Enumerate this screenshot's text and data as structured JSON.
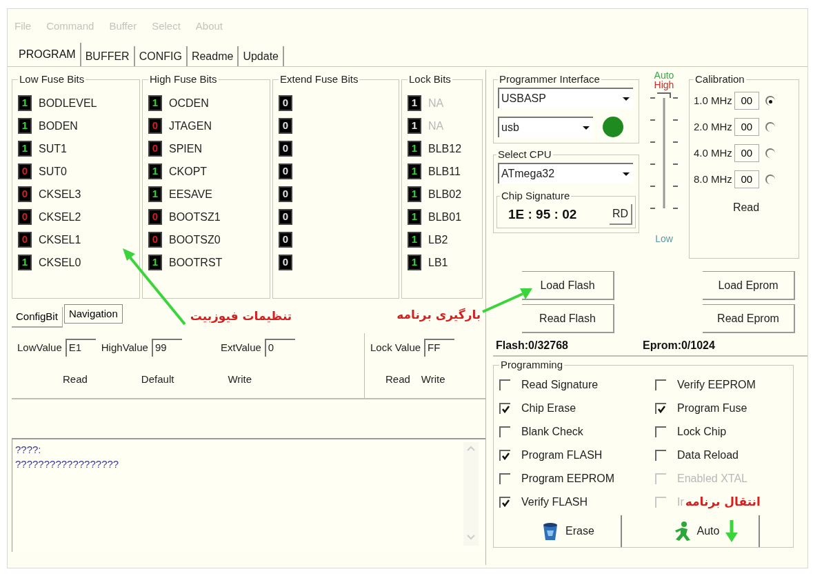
{
  "menu": [
    "File",
    "Command",
    "Buffer",
    "Select",
    "About"
  ],
  "tabs": [
    {
      "label": "PROGRAM",
      "selected": true
    },
    {
      "label": "BUFFER",
      "selected": false
    },
    {
      "label": "CONFIG",
      "selected": false
    },
    {
      "label": "Readme",
      "selected": false
    },
    {
      "label": "Update",
      "selected": false
    }
  ],
  "fuse_groups": [
    {
      "title": "Low Fuse Bits",
      "bits": [
        {
          "value": "1",
          "name": "BODLEVEL",
          "set": true,
          "active": true
        },
        {
          "value": "1",
          "name": "BODEN",
          "set": true,
          "active": true
        },
        {
          "value": "1",
          "name": "SUT1",
          "set": true,
          "active": true
        },
        {
          "value": "0",
          "name": "SUT0",
          "set": false,
          "active": true
        },
        {
          "value": "0",
          "name": "CKSEL3",
          "set": false,
          "active": true
        },
        {
          "value": "0",
          "name": "CKSEL2",
          "set": false,
          "active": true
        },
        {
          "value": "0",
          "name": "CKSEL1",
          "set": false,
          "active": true
        },
        {
          "value": "1",
          "name": "CKSEL0",
          "set": true,
          "active": true
        }
      ]
    },
    {
      "title": "High Fuse Bits",
      "bits": [
        {
          "value": "1",
          "name": "OCDEN",
          "set": true,
          "active": true
        },
        {
          "value": "0",
          "name": "JTAGEN",
          "set": false,
          "active": true
        },
        {
          "value": "0",
          "name": "SPIEN",
          "set": false,
          "active": true
        },
        {
          "value": "1",
          "name": "CKOPT",
          "set": true,
          "active": true
        },
        {
          "value": "1",
          "name": "EESAVE",
          "set": true,
          "active": true
        },
        {
          "value": "0",
          "name": "BOOTSZ1",
          "set": false,
          "active": true
        },
        {
          "value": "0",
          "name": "BOOTSZ0",
          "set": false,
          "active": true
        },
        {
          "value": "1",
          "name": "BOOTRST",
          "set": true,
          "active": true
        }
      ]
    },
    {
      "title": "Extend Fuse Bits",
      "bits": [
        {
          "value": "0",
          "active": false
        },
        {
          "value": "0",
          "active": false
        },
        {
          "value": "0",
          "active": false
        },
        {
          "value": "0",
          "active": false
        },
        {
          "value": "0",
          "active": false
        },
        {
          "value": "0",
          "active": false
        },
        {
          "value": "0",
          "active": false
        },
        {
          "value": "0",
          "active": false
        }
      ]
    },
    {
      "title": "Lock Bits",
      "bits": [
        {
          "value": "1",
          "name": "NA",
          "active": false
        },
        {
          "value": "1",
          "name": "NA",
          "active": false
        },
        {
          "value": "1",
          "name": "BLB12",
          "set": true,
          "active": true
        },
        {
          "value": "1",
          "name": "BLB11",
          "set": true,
          "active": true
        },
        {
          "value": "1",
          "name": "BLB02",
          "set": true,
          "active": true
        },
        {
          "value": "1",
          "name": "BLB01",
          "set": true,
          "active": true
        },
        {
          "value": "1",
          "name": "LB2",
          "set": true,
          "active": true
        },
        {
          "value": "1",
          "name": "LB1",
          "set": true,
          "active": true
        }
      ]
    }
  ],
  "sub_tabs": [
    {
      "label": "ConfigBit",
      "selected": false
    },
    {
      "label": "Navigation",
      "selected": true
    }
  ],
  "fuse_note": "تنظیمات فیوزبیت",
  "load_note": "بارگیری برنامه",
  "transfer_note": "انتقال برنامه",
  "fuse_values": {
    "fields": [
      {
        "label": "LowValue",
        "value": "E1"
      },
      {
        "label": "HighValue",
        "value": "99"
      },
      {
        "label": "ExtValue",
        "value": "0"
      }
    ],
    "buttons": [
      "Read",
      "Default",
      "Write"
    ]
  },
  "lock_values": {
    "field": {
      "label": "Lock Value",
      "value": "FF"
    },
    "buttons": [
      "Read",
      "Write"
    ]
  },
  "log": [
    "????:",
    "??????????????????"
  ],
  "programmer_interface": {
    "title": "Programmer Interface",
    "programmer": "USBASP",
    "port": "usb",
    "led_on": true
  },
  "select_cpu": {
    "title": "Select CPU",
    "value": "ATmega32",
    "chip_signature": {
      "title": "Chip Signature",
      "value": "1E : 95 : 02",
      "button": "RD"
    }
  },
  "speed_slider": {
    "auto_label": "Auto",
    "high_label": "High",
    "low_label": "Low",
    "level": 1
  },
  "calibration": {
    "title": "Calibration",
    "rows": [
      {
        "frequency": "1.0 MHz",
        "value": "00",
        "selected": true
      },
      {
        "frequency": "2.0 MHz",
        "value": "00",
        "selected": false
      },
      {
        "frequency": "4.0 MHz",
        "value": "00",
        "selected": false
      },
      {
        "frequency": "8.0 MHz",
        "value": "00",
        "selected": false
      }
    ],
    "button": "Read"
  },
  "memory_buttons": [
    "Load Flash",
    "Load Eprom",
    "Read Flash",
    "Read Eprom"
  ],
  "counters": [
    "Flash:0/32768",
    "Eprom:0/1024"
  ],
  "programming": {
    "title": "Programming",
    "options": [
      {
        "label": "Read Signature",
        "checked": false,
        "disabled": false
      },
      {
        "label": "Verify EEPROM",
        "checked": false,
        "disabled": false
      },
      {
        "label": "Chip Erase",
        "checked": true,
        "disabled": false
      },
      {
        "label": "Program Fuse",
        "checked": true,
        "disabled": false
      },
      {
        "label": "Blank Check",
        "checked": false,
        "disabled": false
      },
      {
        "label": "Lock Chip",
        "checked": false,
        "disabled": false
      },
      {
        "label": "Program FLASH",
        "checked": true,
        "disabled": false
      },
      {
        "label": "Data Reload",
        "checked": false,
        "disabled": false
      },
      {
        "label": "Program EEPROM",
        "checked": false,
        "disabled": false
      },
      {
        "label": "Enabled XTAL",
        "checked": false,
        "disabled": true
      },
      {
        "label": "Verify FLASH",
        "checked": true,
        "disabled": false
      },
      {
        "label": "Ir",
        "checked": false,
        "disabled": true
      }
    ],
    "buttons": [
      {
        "kind": "erase",
        "label": "Erase"
      },
      {
        "kind": "auto",
        "label": "Auto"
      }
    ]
  }
}
